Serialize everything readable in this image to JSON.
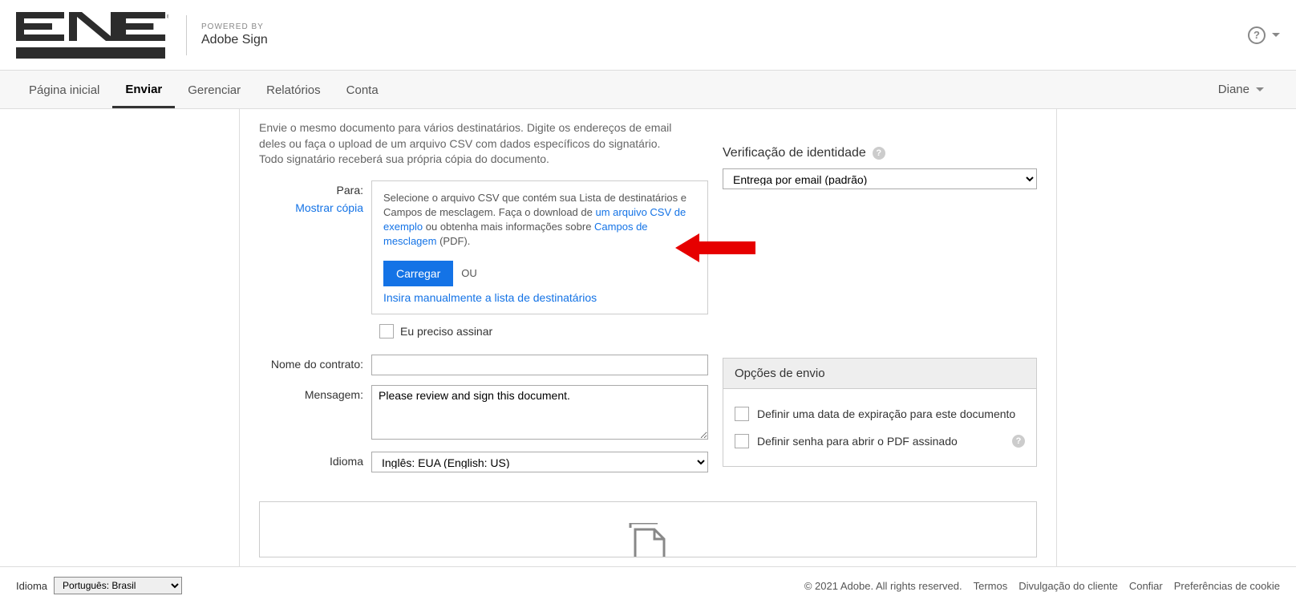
{
  "header": {
    "powered_by_label": "POWERED BY",
    "adobe_sign": "Adobe Sign"
  },
  "nav": {
    "home": "Página inicial",
    "send": "Enviar",
    "manage": "Gerenciar",
    "reports": "Relatórios",
    "account": "Conta",
    "user": "Diane"
  },
  "intro": "Envie o mesmo documento para vários destinatários. Digite os endereços de email deles ou faça o upload de um arquivo CSV com dados específicos do signatário. Todo signatário receberá sua própria cópia do documento.",
  "fields": {
    "to_label": "Para:",
    "show_copy": "Mostrar cópia",
    "contract_name_label": "Nome do contrato:",
    "message_label": "Mensagem:",
    "message_value": "Please review and sign this document.",
    "language_label": "Idioma",
    "language_value": "Inglês: EUA (English: US)"
  },
  "csv": {
    "text1": "Selecione o arquivo CSV que contém sua Lista de destinatários e Campos de mesclagem. Faça o download de ",
    "link1": "um arquivo CSV de exemplo",
    "text2": " ou obtenha mais informações sobre ",
    "link2": "Campos de mesclagem",
    "text3": " (PDF).",
    "upload_btn": "Carregar",
    "or_label": "OU",
    "manual_link": "Insira manualmente a lista de destinatários"
  },
  "need_sign": {
    "label": "Eu preciso assinar"
  },
  "identity": {
    "heading": "Verificação de identidade",
    "select_value": "Entrega por email (padrão)"
  },
  "send_options": {
    "heading": "Opções de envio",
    "expiration": "Definir uma data de expiração para este documento",
    "password": "Definir senha para abrir o PDF assinado"
  },
  "footer": {
    "lang_label": "Idioma",
    "lang_value": "Português: Brasil",
    "copyright": "© 2021 Adobe. All rights reserved.",
    "terms": "Termos",
    "disclosure": "Divulgação do cliente",
    "trust": "Confiar",
    "cookies": "Preferências de cookie"
  }
}
